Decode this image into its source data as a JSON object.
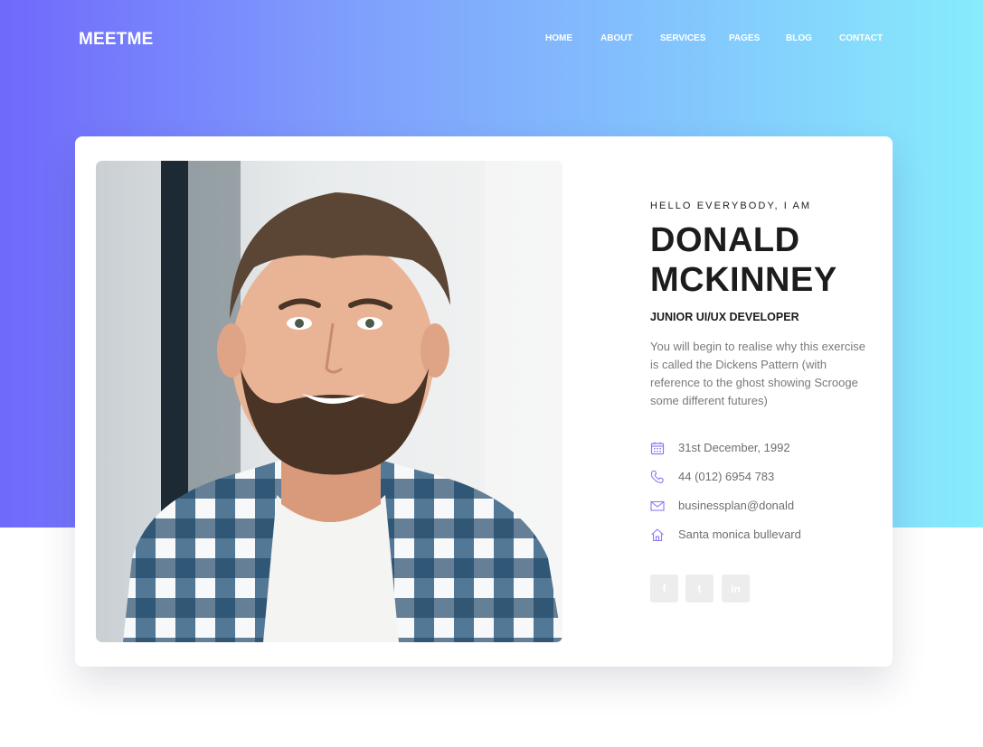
{
  "header": {
    "logo": "MEETME",
    "nav": [
      "HOME",
      "ABOUT",
      "SERVICES",
      "PAGES",
      "BLOG",
      "CONTACT"
    ]
  },
  "profile": {
    "greeting": "HELLO EVERYBODY, I AM",
    "name_line1": "DONALD",
    "name_line2": "MCKINNEY",
    "job_title": "JUNIOR UI/UX DEVELOPER",
    "bio": "You will begin to realise why this exercise is called the Dickens Pattern (with reference to the ghost showing Scrooge some different futures)",
    "details": [
      {
        "icon": "calendar-icon",
        "text": "31st December, 1992"
      },
      {
        "icon": "phone-icon",
        "text": "44 (012) 6954 783"
      },
      {
        "icon": "mail-icon",
        "text": "businessplan@donald"
      },
      {
        "icon": "home-icon",
        "text": "Santa monica bullevard"
      }
    ],
    "socials": [
      {
        "icon": "facebook-icon",
        "glyph": "f"
      },
      {
        "icon": "twitter-icon",
        "glyph": "t"
      },
      {
        "icon": "linkedin-icon",
        "glyph": "in"
      }
    ]
  },
  "colors": {
    "gradient_start": "#7069fb",
    "gradient_end": "#87ecfc",
    "icon_accent": "#8a7bf0",
    "heading": "#1c1c1c",
    "body_text": "#7a7a7a"
  }
}
